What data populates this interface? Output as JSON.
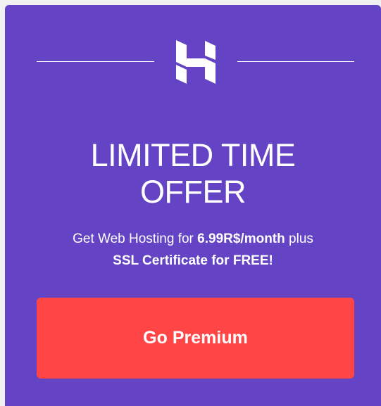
{
  "colors": {
    "card_background": "#6444c4",
    "button_background": "#ff4546",
    "text": "#ffffff"
  },
  "logo": {
    "icon": "hostinger-logo-icon"
  },
  "title": {
    "line1": "LIMITED TIME",
    "line2": "OFFER"
  },
  "subtitle": {
    "prefix": "Get Web Hosting for ",
    "price": "6.99R$/month",
    "middle": " plus",
    "bonus": "SSL Certificate for FREE!"
  },
  "cta": {
    "label": "Go Premium"
  }
}
